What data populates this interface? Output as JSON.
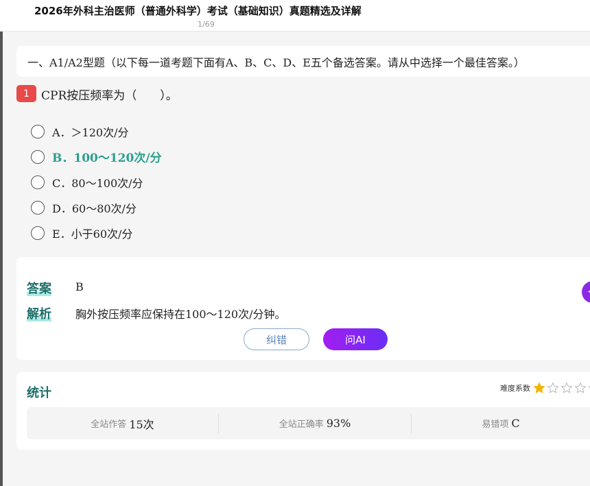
{
  "header": {
    "title": "2026年外科主治医师（普通外科学）考试（基础知识）真题精选及详解",
    "page": "1/69"
  },
  "section": {
    "title": "一、A1/A2型题（以下每一道考题下面有A、B、C、D、E五个备选答案。请从中选择一个最佳答案。）"
  },
  "question": {
    "number": "1",
    "stem": "CPR按压频率为（　　）。",
    "options": [
      {
        "text": "A．＞120次/分"
      },
      {
        "text": "B．100～120次/分"
      },
      {
        "text": "C．80～100次/分"
      },
      {
        "text": "D．60～80次/分"
      },
      {
        "text": "E．小于60次/分"
      }
    ]
  },
  "answer": {
    "label": "答案",
    "value": "B",
    "analysis_label": "解析",
    "analysis_text": "胸外按压频率应保持在100～120次/分钟。",
    "report_button": "纠错",
    "ai_button": "问AI"
  },
  "stats": {
    "title": "统计",
    "difficulty_label": "难度系数",
    "difficulty_stars": 1,
    "difficulty_max": 5,
    "attempts_label": "全站作答",
    "attempts_value": "15次",
    "accuracy_label": "全站正确率",
    "accuracy_value": "93%",
    "common_wrong_label": "易错项",
    "common_wrong_value": "C"
  },
  "colors": {
    "correct": "#2b9f8e",
    "label_teal": "#1d6f6a",
    "badge": "#e84a4a",
    "ai_gradient_start": "#a21ef0",
    "ai_gradient_end": "#6a2ef5",
    "star_filled": "#f5b400",
    "star_empty": "#bdbdbd"
  }
}
